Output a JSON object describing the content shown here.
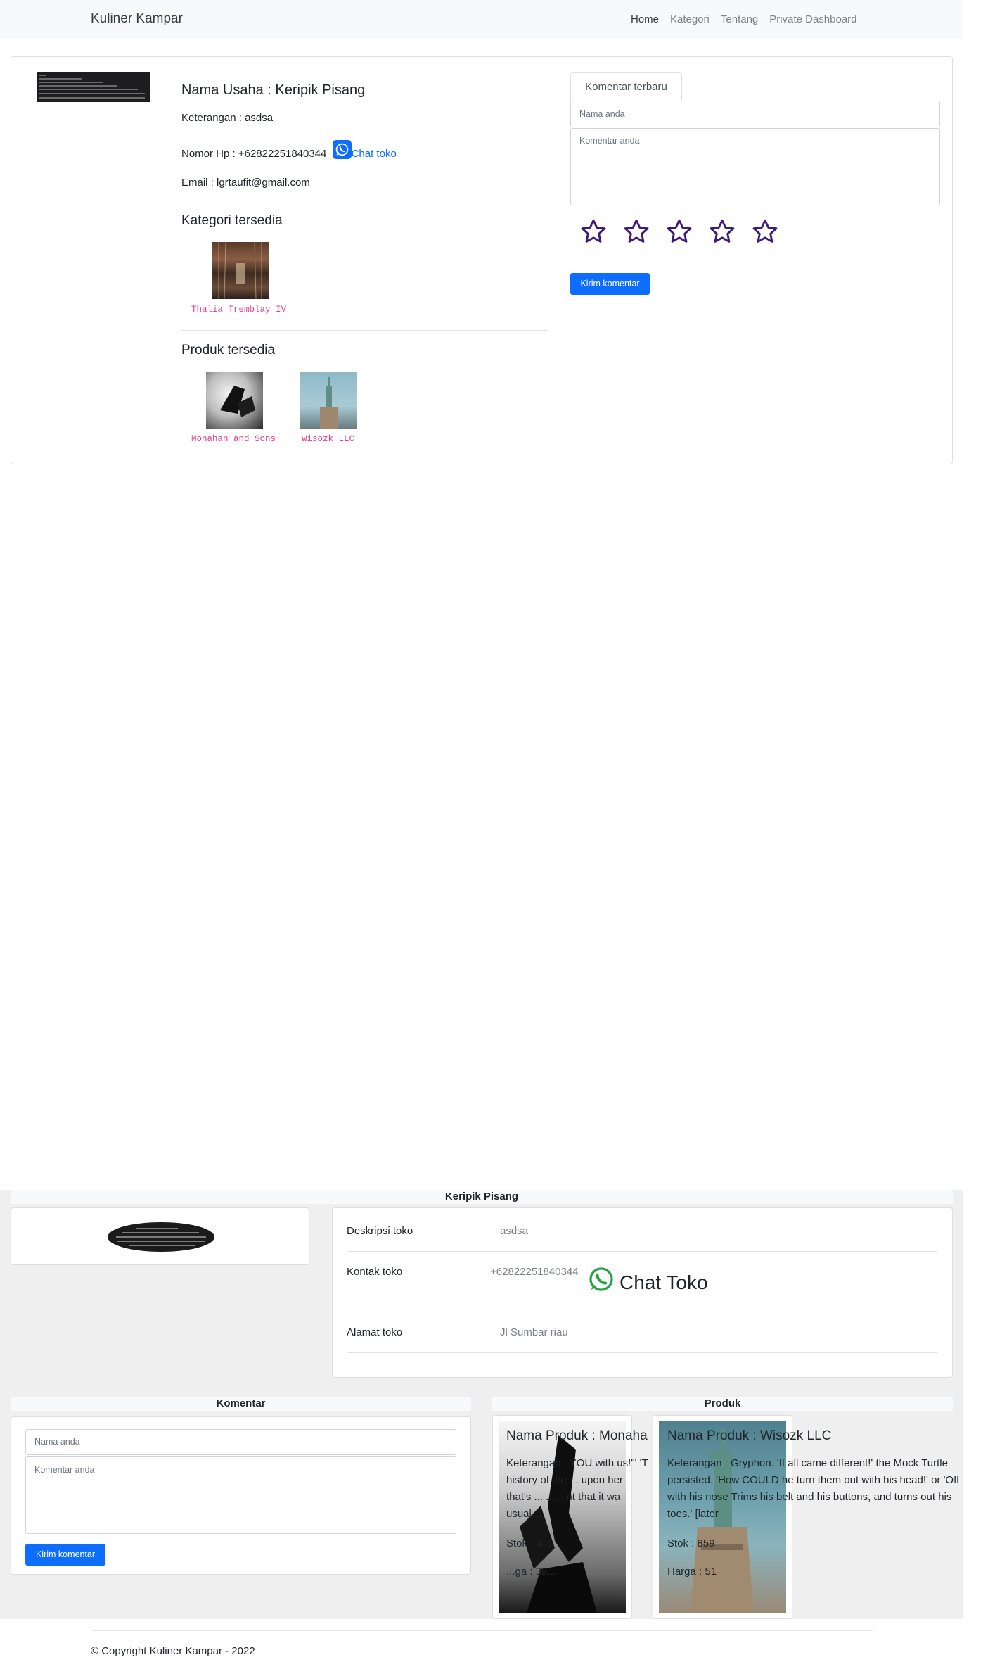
{
  "navbar": {
    "brand": "Kuliner Kampar",
    "items": [
      {
        "label": "Home",
        "active": true
      },
      {
        "label": "Kategori",
        "active": false
      },
      {
        "label": "Tentang",
        "active": false
      },
      {
        "label": "Private Dashboard",
        "active": false
      }
    ]
  },
  "store": {
    "name_line": "Nama Usaha : Keripik Pisang",
    "description_line": "Keterangan : asdsa",
    "phone_line": "Nomor Hp : +62822251840344",
    "chat_link": "Chat toko",
    "email_line": "Email : lgrtaufit@gmail.com"
  },
  "categories": {
    "title": "Kategori tersedia",
    "items": [
      {
        "label": "Thalia Tremblay IV"
      }
    ]
  },
  "products_top": {
    "title": "Produk tersedia",
    "items": [
      {
        "label": "Monahan and Sons"
      },
      {
        "label": "Wisozk LLC"
      }
    ]
  },
  "comment_form_top": {
    "tab_label": "Komentar terbaru",
    "name_placeholder": "Nama anda",
    "comment_placeholder": "Komentar anda",
    "star_count": 5,
    "submit_label": "Kirim komentar"
  },
  "detail": {
    "header": "Keripik Pisang",
    "rows": [
      {
        "label": "Deskripsi toko",
        "value": "asdsa"
      },
      {
        "label": "Kontak toko",
        "value": "+62822251840344",
        "action": "Chat Toko"
      },
      {
        "label": "Alamat toko",
        "value": "Jl Sumbar riau"
      }
    ]
  },
  "comment_form_bottom": {
    "header": "Komentar",
    "name_placeholder": "Nama anda",
    "comment_placeholder": "Komentar anda",
    "submit_label": "Kirim komentar"
  },
  "products_bottom": {
    "header": "Produk",
    "items": [
      {
        "name": "Nama Produk : Monaha",
        "desc": [
          "Keterangan : YOU with us!\"' 'T",
          "history of the ... upon her",
          "that's ... ... ...nt that it wa",
          "usual..."
        ],
        "stock": "Stok : 4...",
        "price": "...ga : 39..."
      },
      {
        "name": "Nama Produk : Wisozk LLC",
        "desc": [
          "Keterangan : Gryphon. 'It all came different!' the Mock Turtle",
          "persisted. 'How COULD he turn them out with his head!' or 'Off",
          "with his nose Trims his belt and his buttons, and turns out his",
          "toes.' [later"
        ],
        "stock": "Stok : 859",
        "price": "Harga : 51"
      }
    ]
  },
  "colors": {
    "primary": "#0d6efd",
    "star": "#3d1a78",
    "whatsapp": "#25a244",
    "code_pink": "#e83e8c"
  },
  "footer": {
    "text": "© Copyright Kuliner Kampar - 2022"
  }
}
